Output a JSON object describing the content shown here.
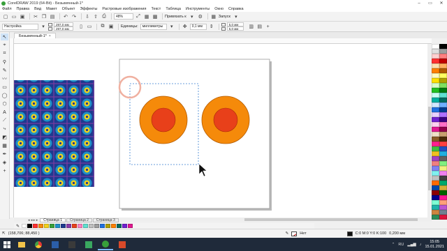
{
  "window": {
    "title": "CorelDRAW 2019 (64-Bit) - Безымянный-1*",
    "controls": {
      "minimize": "–",
      "maximize": "▭",
      "close": "✕"
    }
  },
  "menu": [
    "Файл",
    "Правка",
    "Вид",
    "Макет",
    "Объект",
    "Эффекты",
    "Растровые изображения",
    "Текст",
    "Таблица",
    "Инструменты",
    "Окно",
    "Справка"
  ],
  "toolbar1": {
    "zoom": "48%",
    "snap_label": "Привязать к",
    "launch_label": "Запуск"
  },
  "toolbar2": {
    "preset": "Настройка",
    "width": "297,0 мм",
    "height": "297,0 мм",
    "units_label": "Единицы:",
    "units_value": "миллиметры",
    "nudge": "0,1 мм",
    "dup_x": "5,0 мм",
    "dup_y": "5,0 мм"
  },
  "doc_tab": {
    "label": "Безымянный-1*",
    "close": "×"
  },
  "page_tabs": {
    "nav": "◂ ◂ ▸ ▸",
    "tabs": [
      "Страница 1",
      "Страница 2",
      "Страница 3"
    ],
    "active": 0
  },
  "status": {
    "coords": "(158,706; 88,450 )",
    "outline_label": "Нет",
    "fill_label": "C:0 M:0 Y:0 K:100",
    "stroke_width": "0,200 мм"
  },
  "taskbar": {
    "lang": "RU",
    "time": "15:05",
    "date": "15.01.2021"
  },
  "colors": {
    "orange": "#f58a0a",
    "red": "#e8401a",
    "pattern_bg": "#1e3a8f",
    "pattern_ring": "#1e90c8",
    "pattern_dot": "#f2d21b",
    "pattern_accent": "#8a3aa8"
  }
}
